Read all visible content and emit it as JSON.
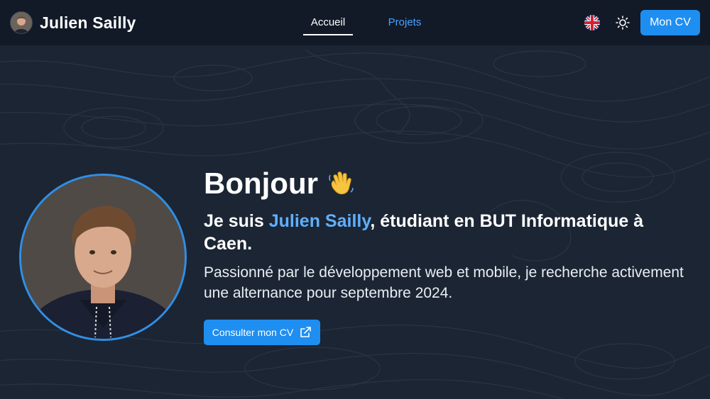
{
  "header": {
    "brand_name": "Julien Sailly",
    "nav": [
      {
        "label": "Accueil",
        "active": true
      },
      {
        "label": "Projets",
        "active": false
      }
    ],
    "cv_button_label": "Mon CV"
  },
  "hero": {
    "greeting": "Bonjour",
    "intro_prefix": "Je suis ",
    "intro_name": "Julien Sailly",
    "intro_suffix": ", étudiant en BUT Informatique à Caen.",
    "description": "Passionné par le développement web et mobile, je recherche activement une alternance pour septembre 2024.",
    "consult_button_label": "Consulter mon CV"
  },
  "icons": {
    "flag": "uk-flag-icon",
    "theme": "sun-icon",
    "wave": "waving-hand-icon",
    "external": "external-link-icon"
  },
  "colors": {
    "background": "#1c2533",
    "header": "#121a28",
    "accent": "#1f8ef1",
    "link": "#4aa3ff",
    "highlight": "#5eb0ff"
  }
}
